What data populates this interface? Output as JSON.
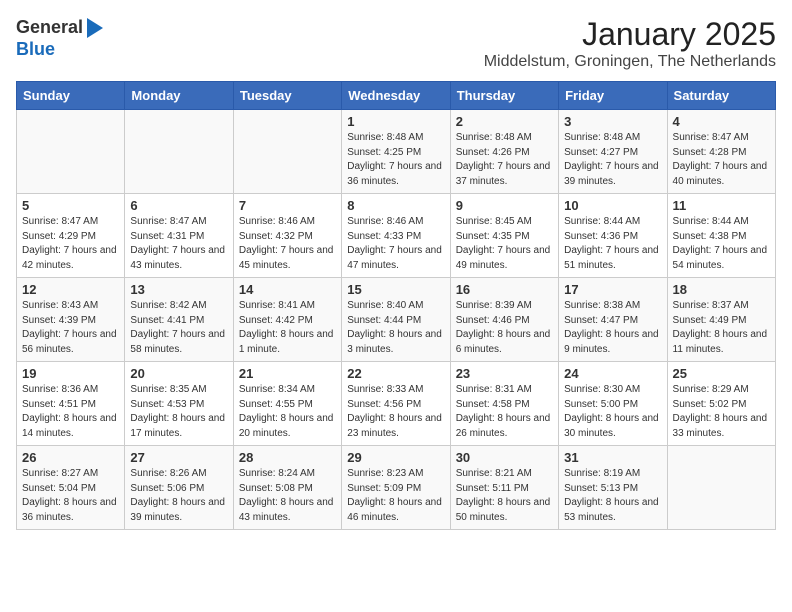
{
  "header": {
    "logo_general": "General",
    "logo_blue": "Blue",
    "month": "January 2025",
    "location": "Middelstum, Groningen, The Netherlands"
  },
  "weekdays": [
    "Sunday",
    "Monday",
    "Tuesday",
    "Wednesday",
    "Thursday",
    "Friday",
    "Saturday"
  ],
  "weeks": [
    [
      {
        "day": "",
        "sunrise": "",
        "sunset": "",
        "daylight": ""
      },
      {
        "day": "",
        "sunrise": "",
        "sunset": "",
        "daylight": ""
      },
      {
        "day": "",
        "sunrise": "",
        "sunset": "",
        "daylight": ""
      },
      {
        "day": "1",
        "sunrise": "Sunrise: 8:48 AM",
        "sunset": "Sunset: 4:25 PM",
        "daylight": "Daylight: 7 hours and 36 minutes."
      },
      {
        "day": "2",
        "sunrise": "Sunrise: 8:48 AM",
        "sunset": "Sunset: 4:26 PM",
        "daylight": "Daylight: 7 hours and 37 minutes."
      },
      {
        "day": "3",
        "sunrise": "Sunrise: 8:48 AM",
        "sunset": "Sunset: 4:27 PM",
        "daylight": "Daylight: 7 hours and 39 minutes."
      },
      {
        "day": "4",
        "sunrise": "Sunrise: 8:47 AM",
        "sunset": "Sunset: 4:28 PM",
        "daylight": "Daylight: 7 hours and 40 minutes."
      }
    ],
    [
      {
        "day": "5",
        "sunrise": "Sunrise: 8:47 AM",
        "sunset": "Sunset: 4:29 PM",
        "daylight": "Daylight: 7 hours and 42 minutes."
      },
      {
        "day": "6",
        "sunrise": "Sunrise: 8:47 AM",
        "sunset": "Sunset: 4:31 PM",
        "daylight": "Daylight: 7 hours and 43 minutes."
      },
      {
        "day": "7",
        "sunrise": "Sunrise: 8:46 AM",
        "sunset": "Sunset: 4:32 PM",
        "daylight": "Daylight: 7 hours and 45 minutes."
      },
      {
        "day": "8",
        "sunrise": "Sunrise: 8:46 AM",
        "sunset": "Sunset: 4:33 PM",
        "daylight": "Daylight: 7 hours and 47 minutes."
      },
      {
        "day": "9",
        "sunrise": "Sunrise: 8:45 AM",
        "sunset": "Sunset: 4:35 PM",
        "daylight": "Daylight: 7 hours and 49 minutes."
      },
      {
        "day": "10",
        "sunrise": "Sunrise: 8:44 AM",
        "sunset": "Sunset: 4:36 PM",
        "daylight": "Daylight: 7 hours and 51 minutes."
      },
      {
        "day": "11",
        "sunrise": "Sunrise: 8:44 AM",
        "sunset": "Sunset: 4:38 PM",
        "daylight": "Daylight: 7 hours and 54 minutes."
      }
    ],
    [
      {
        "day": "12",
        "sunrise": "Sunrise: 8:43 AM",
        "sunset": "Sunset: 4:39 PM",
        "daylight": "Daylight: 7 hours and 56 minutes."
      },
      {
        "day": "13",
        "sunrise": "Sunrise: 8:42 AM",
        "sunset": "Sunset: 4:41 PM",
        "daylight": "Daylight: 7 hours and 58 minutes."
      },
      {
        "day": "14",
        "sunrise": "Sunrise: 8:41 AM",
        "sunset": "Sunset: 4:42 PM",
        "daylight": "Daylight: 8 hours and 1 minute."
      },
      {
        "day": "15",
        "sunrise": "Sunrise: 8:40 AM",
        "sunset": "Sunset: 4:44 PM",
        "daylight": "Daylight: 8 hours and 3 minutes."
      },
      {
        "day": "16",
        "sunrise": "Sunrise: 8:39 AM",
        "sunset": "Sunset: 4:46 PM",
        "daylight": "Daylight: 8 hours and 6 minutes."
      },
      {
        "day": "17",
        "sunrise": "Sunrise: 8:38 AM",
        "sunset": "Sunset: 4:47 PM",
        "daylight": "Daylight: 8 hours and 9 minutes."
      },
      {
        "day": "18",
        "sunrise": "Sunrise: 8:37 AM",
        "sunset": "Sunset: 4:49 PM",
        "daylight": "Daylight: 8 hours and 11 minutes."
      }
    ],
    [
      {
        "day": "19",
        "sunrise": "Sunrise: 8:36 AM",
        "sunset": "Sunset: 4:51 PM",
        "daylight": "Daylight: 8 hours and 14 minutes."
      },
      {
        "day": "20",
        "sunrise": "Sunrise: 8:35 AM",
        "sunset": "Sunset: 4:53 PM",
        "daylight": "Daylight: 8 hours and 17 minutes."
      },
      {
        "day": "21",
        "sunrise": "Sunrise: 8:34 AM",
        "sunset": "Sunset: 4:55 PM",
        "daylight": "Daylight: 8 hours and 20 minutes."
      },
      {
        "day": "22",
        "sunrise": "Sunrise: 8:33 AM",
        "sunset": "Sunset: 4:56 PM",
        "daylight": "Daylight: 8 hours and 23 minutes."
      },
      {
        "day": "23",
        "sunrise": "Sunrise: 8:31 AM",
        "sunset": "Sunset: 4:58 PM",
        "daylight": "Daylight: 8 hours and 26 minutes."
      },
      {
        "day": "24",
        "sunrise": "Sunrise: 8:30 AM",
        "sunset": "Sunset: 5:00 PM",
        "daylight": "Daylight: 8 hours and 30 minutes."
      },
      {
        "day": "25",
        "sunrise": "Sunrise: 8:29 AM",
        "sunset": "Sunset: 5:02 PM",
        "daylight": "Daylight: 8 hours and 33 minutes."
      }
    ],
    [
      {
        "day": "26",
        "sunrise": "Sunrise: 8:27 AM",
        "sunset": "Sunset: 5:04 PM",
        "daylight": "Daylight: 8 hours and 36 minutes."
      },
      {
        "day": "27",
        "sunrise": "Sunrise: 8:26 AM",
        "sunset": "Sunset: 5:06 PM",
        "daylight": "Daylight: 8 hours and 39 minutes."
      },
      {
        "day": "28",
        "sunrise": "Sunrise: 8:24 AM",
        "sunset": "Sunset: 5:08 PM",
        "daylight": "Daylight: 8 hours and 43 minutes."
      },
      {
        "day": "29",
        "sunrise": "Sunrise: 8:23 AM",
        "sunset": "Sunset: 5:09 PM",
        "daylight": "Daylight: 8 hours and 46 minutes."
      },
      {
        "day": "30",
        "sunrise": "Sunrise: 8:21 AM",
        "sunset": "Sunset: 5:11 PM",
        "daylight": "Daylight: 8 hours and 50 minutes."
      },
      {
        "day": "31",
        "sunrise": "Sunrise: 8:19 AM",
        "sunset": "Sunset: 5:13 PM",
        "daylight": "Daylight: 8 hours and 53 minutes."
      },
      {
        "day": "",
        "sunrise": "",
        "sunset": "",
        "daylight": ""
      }
    ]
  ]
}
